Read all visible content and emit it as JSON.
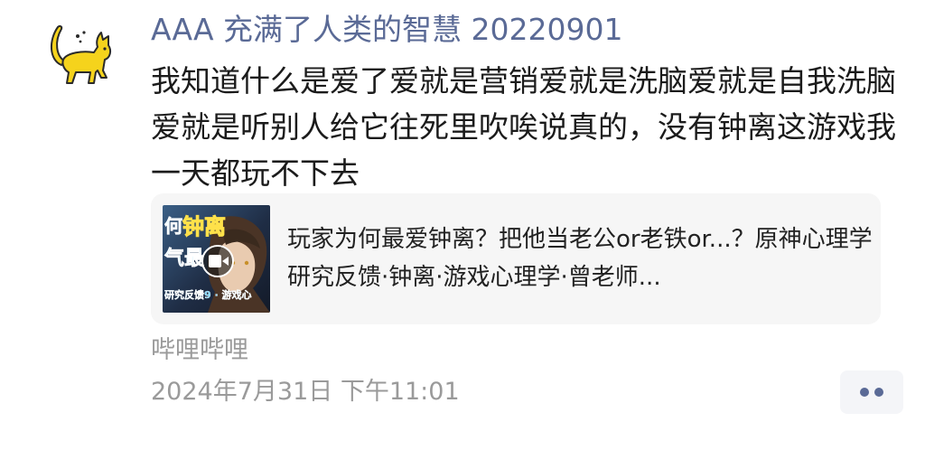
{
  "post": {
    "username": "AAA 充满了人类的智慧 20220901",
    "text": "我知道什么是爱了爱就是营销爱就是洗脑爱就是自我洗脑爱就是听别人给它往死里吹唉说真的，没有钟离这游戏我一天都玩不下去",
    "avatar_icon": "yellow-cat-avatar",
    "link_card": {
      "title": "玩家为何最爱钟离？把他当老公or老铁or...？原神心理学研究反馈·钟离·游戏心理学·曾老师...",
      "thumbnail": {
        "label_1": "钟离",
        "label_2": "何",
        "label_3": "气最",
        "label_4": "研究反馈9 · 游戏心",
        "play_icon": "video-play-icon"
      }
    },
    "source": "哔哩哔哩",
    "timestamp": "2024年7月31日 下午11:01",
    "more_icon": "more-dots-icon"
  },
  "colors": {
    "username": "#5a6a96",
    "card_bg": "#f6f6f6",
    "meta_text": "#9a9a9a",
    "avatar_yellow": "#f5d31c"
  }
}
